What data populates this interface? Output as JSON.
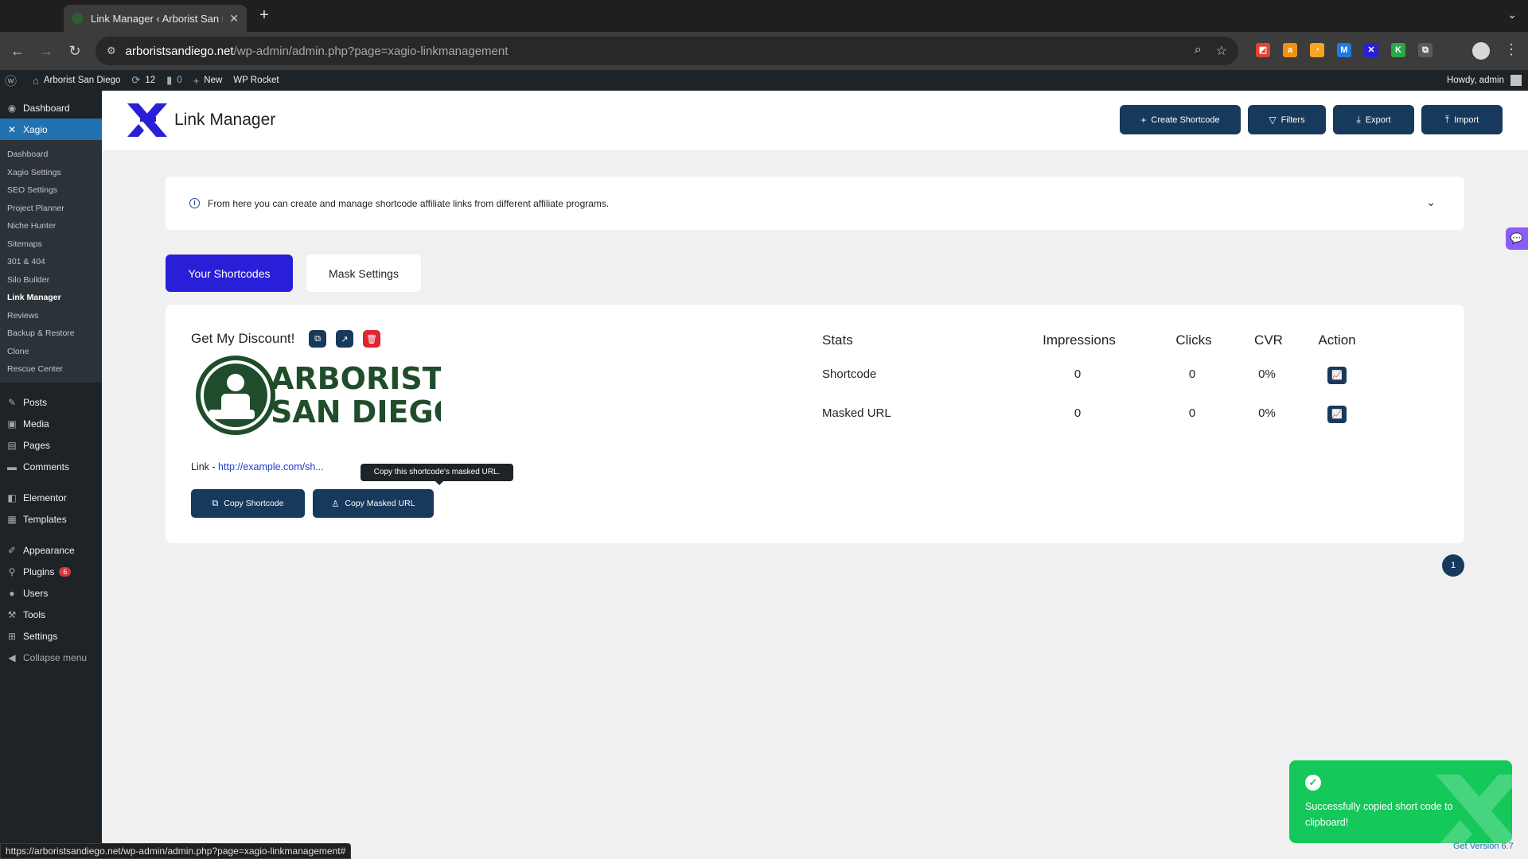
{
  "browser": {
    "tab_title": "Link Manager ‹ Arborist San Diego",
    "new_tab": "+",
    "url_host": "arboristsandiego.net",
    "url_path": "/wp-admin/admin.php?page=xagio-linkmanagement",
    "status_url": "https://arboristsandiego.net/wp-admin/admin.php?page=xagio-linkmanagement#",
    "extensions": [
      {
        "name": "ext-red",
        "glyph": "◩",
        "color": "#e34234"
      },
      {
        "name": "ext-amazon",
        "glyph": "a",
        "color": "#f29111"
      },
      {
        "name": "ext-chart",
        "glyph": "◔",
        "color": "#f5a623"
      },
      {
        "name": "ext-m",
        "glyph": "M",
        "color": "#1d7be0"
      },
      {
        "name": "ext-x",
        "glyph": "✕",
        "color": "#2a1fd8"
      },
      {
        "name": "ext-k",
        "glyph": "K",
        "color": "#2ba84a"
      },
      {
        "name": "ext-puzzle",
        "glyph": "⧉",
        "color": "#5a5a5a"
      }
    ]
  },
  "adminbar": {
    "site_name": "Arborist San Diego",
    "updates_count": "12",
    "comments_count": "0",
    "new_label": "New",
    "wp_rocket": "WP Rocket",
    "howdy": "Howdy, admin"
  },
  "sidebar": {
    "dashboard": "Dashboard",
    "xagio": "Xagio",
    "sub_items": [
      "Dashboard",
      "Xagio Settings",
      "SEO Settings",
      "Project Planner",
      "Niche Hunter",
      "Sitemaps",
      "301 & 404",
      "Silo Builder",
      "Link Manager",
      "Reviews",
      "Backup & Restore",
      "Clone",
      "Rescue Center"
    ],
    "posts": "Posts",
    "media": "Media",
    "pages": "Pages",
    "comments": "Comments",
    "elementor": "Elementor",
    "templates": "Templates",
    "appearance": "Appearance",
    "plugins": "Plugins",
    "plugins_badge": "6",
    "users": "Users",
    "tools": "Tools",
    "settings": "Settings",
    "collapse": "Collapse menu"
  },
  "header": {
    "title": "Link Manager",
    "buttons": {
      "create": "Create Shortcode",
      "filters": "Filters",
      "export": "Export",
      "import": "Import"
    }
  },
  "info": {
    "text": "From here you can create and manage shortcode affiliate links from different affiliate programs."
  },
  "tabs": {
    "shortcodes": "Your Shortcodes",
    "mask": "Mask Settings"
  },
  "card": {
    "title": "Get My Discount!",
    "logo_text_line1": "ARBORIST",
    "logo_text_line2": "SAN DIEGO",
    "link_label": "Link - ",
    "link_url": "http://example.com/sh...",
    "tooltip": "Copy this shortcode's masked URL.",
    "copy_shortcode": "Copy Shortcode",
    "copy_masked": "Copy Masked URL"
  },
  "stats": {
    "headers": {
      "stats": "Stats",
      "impressions": "Impressions",
      "clicks": "Clicks",
      "cvr": "CVR",
      "action": "Action"
    },
    "rows": [
      {
        "name": "Shortcode",
        "impressions": "0",
        "clicks": "0",
        "cvr": "0%"
      },
      {
        "name": "Masked URL",
        "impressions": "0",
        "clicks": "0",
        "cvr": "0%"
      }
    ]
  },
  "pagination": {
    "current": "1"
  },
  "toast": {
    "message": "Successfully copied short code to clipboard!"
  },
  "footer": {
    "get_version": "Get Version 6.7"
  },
  "colors": {
    "accent": "#2a1fd8",
    "navy": "#173a5c",
    "danger": "#e0262f",
    "success": "#14c85a",
    "wp_dark": "#1d2327",
    "wp_blue": "#2271b1",
    "logo_green": "#1f4d2b"
  }
}
